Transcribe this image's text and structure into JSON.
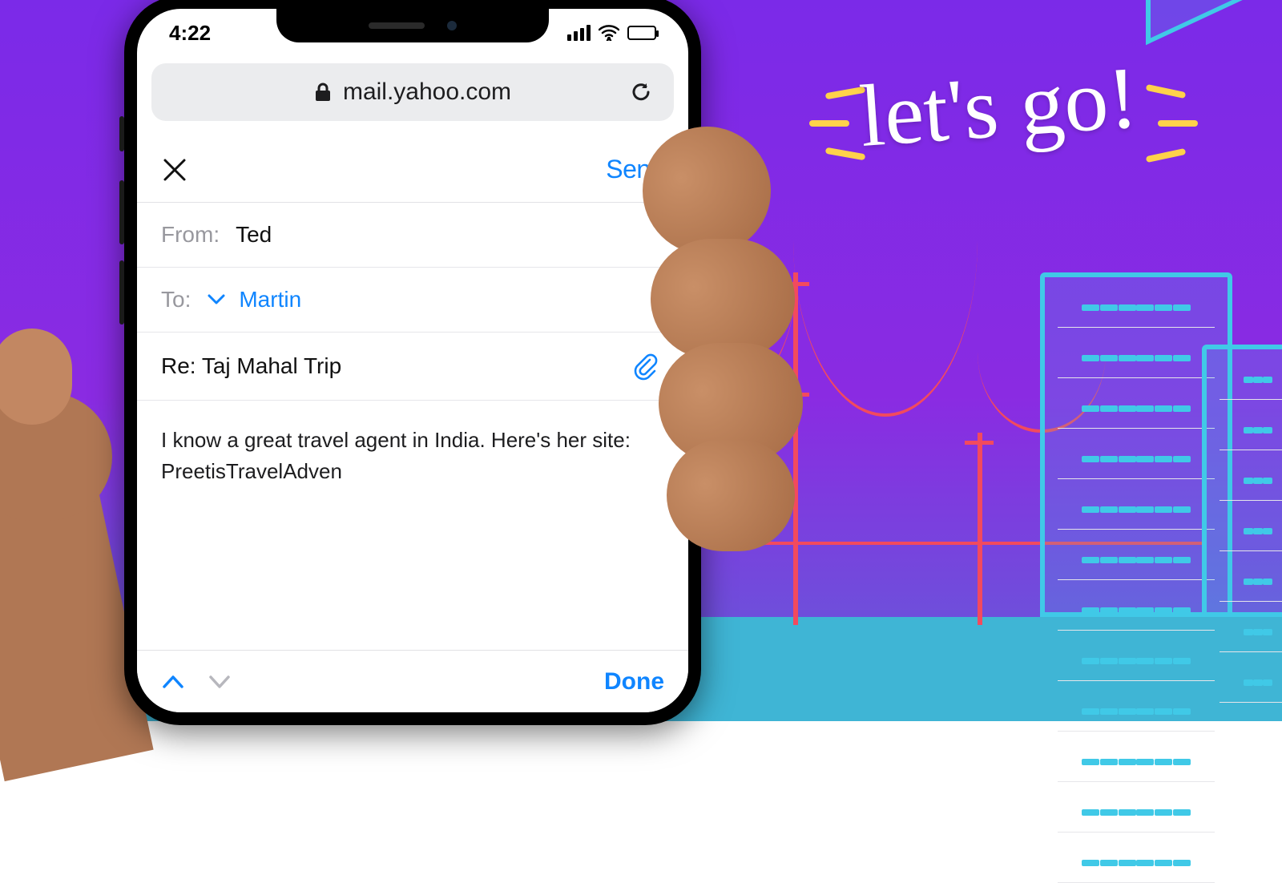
{
  "background": {
    "decor_text": "let's go!"
  },
  "phone": {
    "status_time": "4:22",
    "browser_url": "mail.yahoo.com"
  },
  "compose": {
    "send_label": "Send",
    "from_label": "From:",
    "from_value": "Ted",
    "to_label": "To:",
    "to_value": "Martin",
    "subject": "Re: Taj Mahal Trip",
    "body": "I know a great travel agent in India. Here's her site: PreetisTravelAdven"
  },
  "keyboard": {
    "done_label": "Done"
  }
}
